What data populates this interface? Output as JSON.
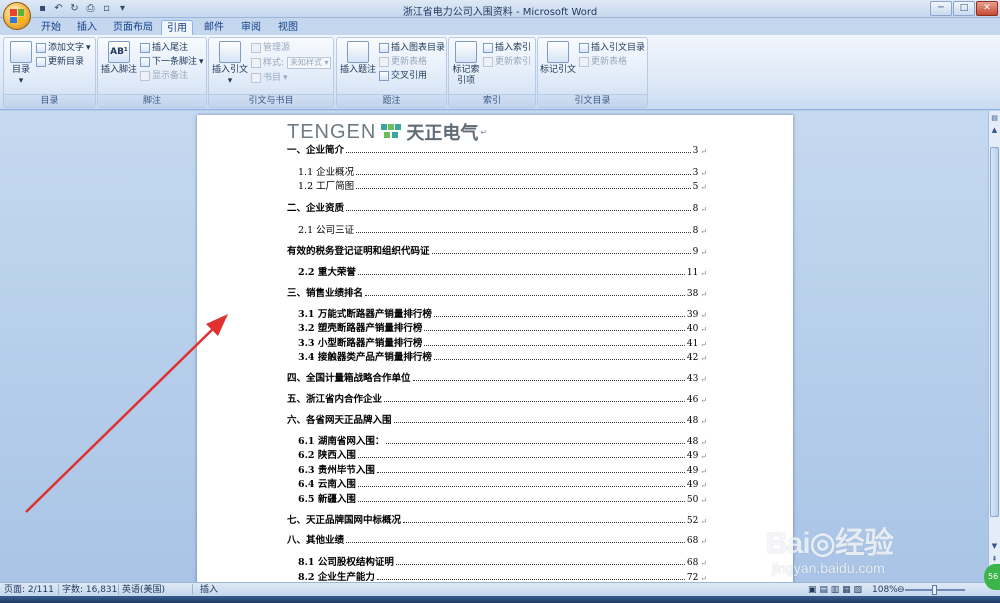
{
  "window": {
    "title": "浙江省电力公司入围资料 - Microsoft Word",
    "controls": {
      "minimize": "─",
      "maximize": "□",
      "close": "✕"
    }
  },
  "qat": {
    "customize": "▾"
  },
  "tabs": [
    {
      "label": "开始",
      "active": false
    },
    {
      "label": "插入",
      "active": false
    },
    {
      "label": "页面布局",
      "active": false
    },
    {
      "label": "引用",
      "active": true
    },
    {
      "label": "邮件",
      "active": false
    },
    {
      "label": "审阅",
      "active": false
    },
    {
      "label": "视图",
      "active": false
    }
  ],
  "ribbon": {
    "toc_group": {
      "label": "目录",
      "toc": "目录",
      "add_text": "添加文字",
      "update_toc": "更新目录"
    },
    "footnote_group": {
      "label": "脚注",
      "insert_footnote": "插入脚注",
      "insert_endnote": "插入尾注",
      "next_footnote": "下一条脚注",
      "show_notes": "显示备注"
    },
    "citation_group": {
      "label": "引文与书目",
      "insert_citation": "插入引文",
      "manage_sources": "管理源",
      "style_label": "样式:",
      "style_value": "未知样式",
      "bibliography": "书目"
    },
    "caption_group": {
      "label": "题注",
      "insert_caption": "插入题注",
      "insert_table_of_figures": "插入图表目录",
      "update_table": "更新表格",
      "cross_reference": "交叉引用"
    },
    "index_group": {
      "label": "索引",
      "mark_entry": "标记索引项",
      "insert_index": "插入索引",
      "update_index": "更新索引"
    },
    "toa_group": {
      "label": "引文目录",
      "mark_citation": "标记引文",
      "insert_toa": "插入引文目录",
      "update_table": "更新表格"
    }
  },
  "document": {
    "logo_en": "TENGEN",
    "logo_cn": "天正电气",
    "return_mark": "↵",
    "toc": [
      {
        "text": "一、企业简介",
        "page": "3",
        "level": 1,
        "bold": true
      },
      {
        "text": "1.1 企业概况",
        "page": "3",
        "level": 2,
        "bold": false
      },
      {
        "text": "1.2 工厂简图",
        "page": "5",
        "level": 2,
        "bold": false
      },
      {
        "text": "二、企业资质",
        "page": "8",
        "level": 1,
        "bold": true
      },
      {
        "text": "2.1 公司三证",
        "page": "8",
        "level": 2,
        "bold": false
      },
      {
        "text": "有效的税务登记证明和组织代码证",
        "page": "9",
        "level": 1,
        "bold": true
      },
      {
        "text": "2.2 重大荣誉",
        "page": "11",
        "level": 2,
        "bold": true
      },
      {
        "text": "三、销售业绩排名",
        "page": "38",
        "level": 1,
        "bold": true
      },
      {
        "text": "3.1 万能式断路器产销量排行榜",
        "page": "39",
        "level": 2,
        "bold": true
      },
      {
        "text": "3.2 塑壳断路器产销量排行榜",
        "page": "40",
        "level": 2,
        "bold": true
      },
      {
        "text": "3.3 小型断路器产销量排行榜",
        "page": "41",
        "level": 2,
        "bold": true
      },
      {
        "text": "3.4 接触器类产品产销量排行榜",
        "page": "42",
        "level": 2,
        "bold": true
      },
      {
        "text": "四、全国计量箱战略合作单位",
        "page": "43",
        "level": 1,
        "bold": true
      },
      {
        "text": "五、浙江省内合作企业",
        "page": "46",
        "level": 1,
        "bold": true
      },
      {
        "text": "六、各省网天正品牌入围",
        "page": "48",
        "level": 1,
        "bold": true
      },
      {
        "text": "6.1 湖南省网入围：",
        "page": "48",
        "level": 2,
        "bold": true
      },
      {
        "text": "6.2 陕西入围",
        "page": "49",
        "level": 2,
        "bold": true
      },
      {
        "text": "6.3 贵州毕节入围",
        "page": "49",
        "level": 2,
        "bold": true
      },
      {
        "text": "6.4 云南入围",
        "page": "49",
        "level": 2,
        "bold": true
      },
      {
        "text": "6.5 新疆入围",
        "page": "50",
        "level": 2,
        "bold": true
      },
      {
        "text": "七、天正品牌国网中标概况",
        "page": "52",
        "level": 1,
        "bold": true
      },
      {
        "text": "八、其他业绩",
        "page": "68",
        "level": 1,
        "bold": true
      },
      {
        "text": "8.1 公司股权结构证明",
        "page": "68",
        "level": 2,
        "bold": true
      },
      {
        "text": "8.2 企业生产能力",
        "page": "72",
        "level": 2,
        "bold": true
      }
    ]
  },
  "statusbar": {
    "page": "页面: 2/111",
    "words": "字数: 16,831",
    "language": "英语(美国)",
    "mode": "插入",
    "zoom": "108%"
  },
  "watermark": {
    "main": "Bai◎经验",
    "sub": "jingyan.baidu.com"
  },
  "badge": "56",
  "colors": {
    "accent": "#15428b",
    "arrow": "#e03030",
    "ribbon_bg": "#dbe7f6"
  }
}
